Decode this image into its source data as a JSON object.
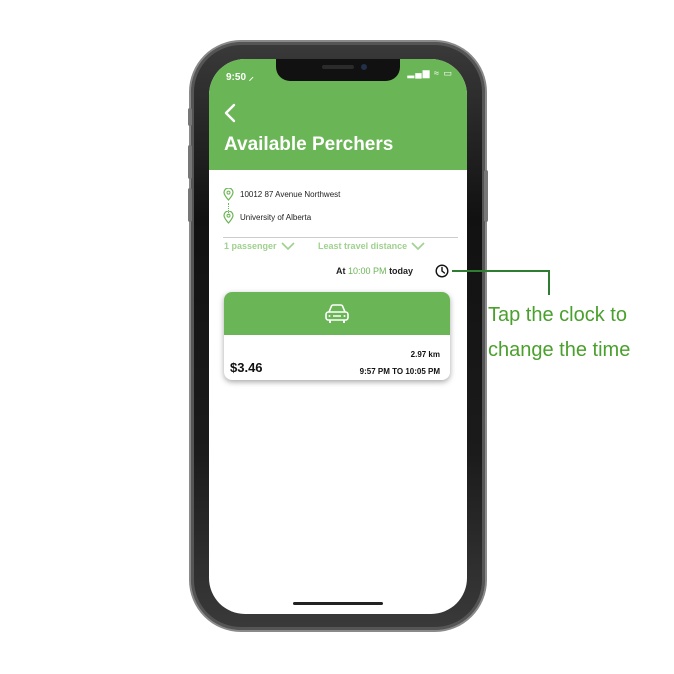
{
  "status_bar": {
    "time": "9:50 ⸝",
    "icons": "▂▄▆ ≈ ▭"
  },
  "header": {
    "title": "Available Perchers"
  },
  "route": {
    "origin": "10012 87 Avenue Northwest",
    "destination": "University of Alberta"
  },
  "filters": {
    "passengers": "1 passenger",
    "sort": "Least travel distance"
  },
  "when": {
    "prefix": "At",
    "time": "10:00 PM",
    "day": "today"
  },
  "ride_card": {
    "price": "$3.46",
    "distance": "2.97 km",
    "times": "9:57 PM TO 10:05 PM"
  },
  "callout": {
    "line1": "Tap the clock to",
    "line2": "change the time"
  },
  "colors": {
    "accent": "#6ab555",
    "filter_text": "#9fd18f",
    "callout": "#4aa02c"
  }
}
